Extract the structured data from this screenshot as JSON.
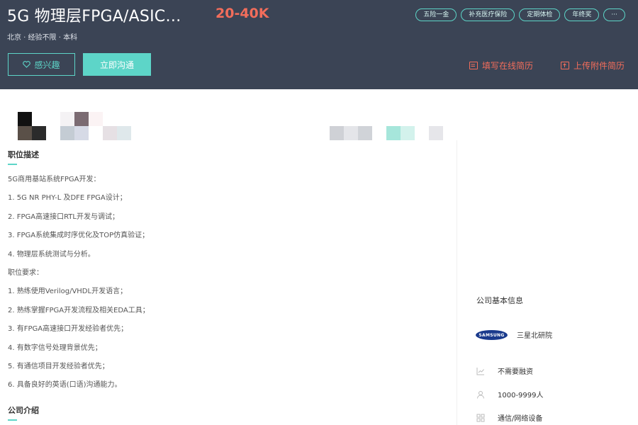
{
  "job": {
    "title": "5G 物理层FPGA/ASIC…",
    "salary": "20-40K",
    "meta": "北京 · 经验不限 · 本科",
    "tags": [
      "五险一金",
      "补充医疗保险",
      "定期体检",
      "年终奖",
      "···"
    ]
  },
  "actions": {
    "interest_label": "感兴趣",
    "chat_label": "立即沟通",
    "online_resume_label": "填写在线简历",
    "upload_resume_label": "上传附件简历"
  },
  "description": {
    "title": "职位描述",
    "lines": [
      "5G商用基站系统FPGA开发：",
      "1. 5G NR PHY-L 及DFE FPGA设计；",
      "2. FPGA高速接口RTL开发与调试；",
      "3. FPGA系统集成时序优化及TOP仿真验证；",
      "4. 物理层系统测试与分析。",
      "职位要求：",
      "1. 熟练使用Verilog/VHDL开发语言；",
      "2. 熟练掌握FPGA开发流程及相关EDA工具；",
      "3. 有FPGA高速接口开发经验者优先；",
      "4. 有数字信号处理背景优先；",
      "5. 有通信项目开发经验者优先；",
      "6. 具备良好的英语(口语)沟通能力。"
    ]
  },
  "company_intro": {
    "title": "公司介绍"
  },
  "company": {
    "section_title": "公司基本信息",
    "logo_text": "SAMSUNG",
    "name": "三星北研院",
    "financing": "不需要融资",
    "size": "1000-9999人",
    "industry": "通信/网络设备"
  },
  "colors": {
    "header_bg": "#3b4455",
    "accent": "#5dd5c8",
    "salary": "#f26d5b"
  }
}
